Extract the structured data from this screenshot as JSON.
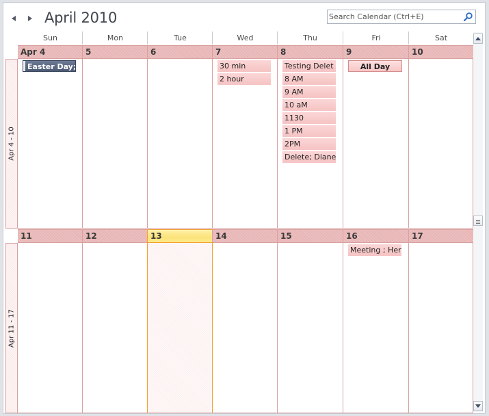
{
  "header": {
    "title": "April 2010",
    "prev_icon": "triangle-left-icon",
    "next_icon": "triangle-right-icon",
    "search": {
      "placeholder": "Search Calendar (Ctrl+E)",
      "value": "",
      "icon": "magnifier-icon"
    }
  },
  "days_of_week": [
    "Sun",
    "Mon",
    "Tue",
    "Wed",
    "Thu",
    "Fri",
    "Sat"
  ],
  "weeks": [
    {
      "label": "Apr 4 - 10",
      "dates": [
        "Apr 4",
        "5",
        "6",
        "7",
        "8",
        "9",
        "10"
      ],
      "appointments": {
        "sun": [
          {
            "text": "Easter Day; U",
            "type": "holiday"
          }
        ],
        "wed": [
          {
            "text": "30 min"
          },
          {
            "text": "2 hour"
          }
        ],
        "thu": [
          {
            "text": "Testing Delet"
          },
          {
            "text": "8 AM"
          },
          {
            "text": "9 AM"
          },
          {
            "text": "10 aM"
          },
          {
            "text": "1130"
          },
          {
            "text": "1 PM"
          },
          {
            "text": "2PM"
          },
          {
            "text": "Delete; Diane"
          }
        ],
        "fri": [
          {
            "text": "All Day",
            "type": "all-day"
          }
        ]
      }
    },
    {
      "label": "Apr 11 - 17",
      "dates": [
        "11",
        "12",
        "13",
        "14",
        "15",
        "16",
        "17"
      ],
      "today": "13",
      "appointments": {
        "fri": [
          {
            "text": "Meeting ; Her"
          }
        ]
      }
    }
  ],
  "colors": {
    "date_row": "#e8b6b6",
    "grid_line": "#d9a0a0",
    "today_border": "#f0a030",
    "today_header": "#fde98a",
    "appointment": "#f6c3c3",
    "holiday": "#4d5a74"
  },
  "scrollbar": {
    "up_icon": "scroll-up-icon",
    "down_icon": "scroll-down-icon",
    "thumb_icon": "grip-icon"
  }
}
